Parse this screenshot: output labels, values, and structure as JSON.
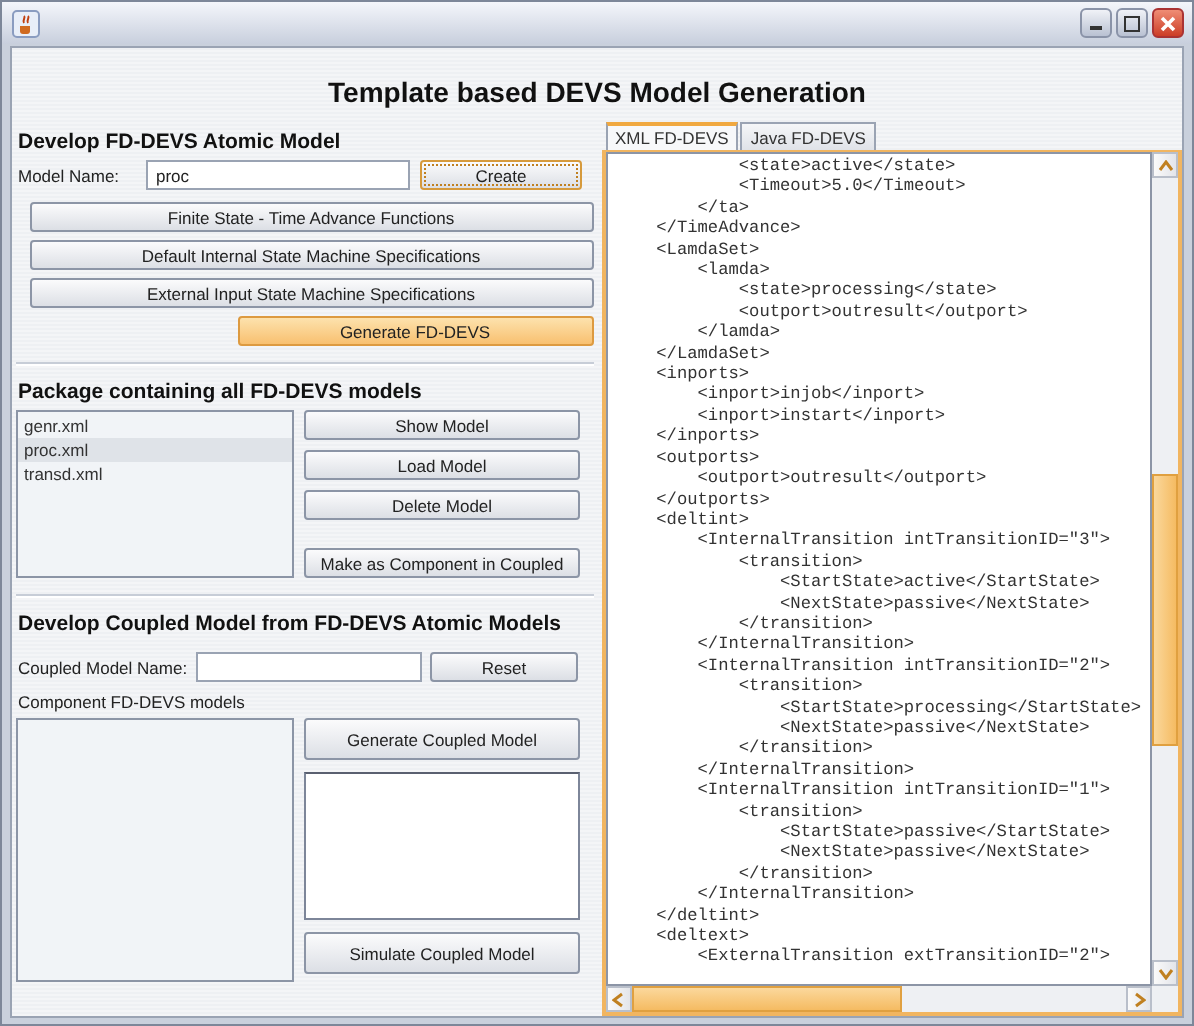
{
  "heading": "Template based DEVS Model Generation",
  "atomic": {
    "title": "Develop FD-DEVS Atomic Model",
    "name_label": "Model Name:",
    "name_value": "proc",
    "create_button": "Create",
    "buttons": [
      {
        "label": "Finite State - Time Advance Functions",
        "highlighted": false
      },
      {
        "label": "Default Internal State Machine Specifications",
        "highlighted": false
      },
      {
        "label": "External Input State Machine Specifications",
        "highlighted": false
      },
      {
        "label": "Generate FD-DEVS",
        "highlighted": true
      }
    ]
  },
  "package": {
    "title": "Package containing all FD-DEVS models",
    "items": [
      {
        "label": "genr.xml",
        "selected": false
      },
      {
        "label": "proc.xml",
        "selected": true
      },
      {
        "label": "transd.xml",
        "selected": false
      }
    ],
    "buttons": [
      "Show Model",
      "Load Model",
      "Delete Model",
      "Make as Component in Coupled"
    ]
  },
  "coupled": {
    "title": "Develop Coupled Model from FD-DEVS Atomic Models",
    "name_label": "Coupled Model Name:",
    "reset_button": "Reset",
    "components_label": "Component FD-DEVS models",
    "generate_button": "Generate Coupled Model",
    "simulate_button": "Simulate Coupled Model"
  },
  "tabs": [
    {
      "label": "XML FD-DEVS",
      "selected": true
    },
    {
      "label": "Java FD-DEVS",
      "selected": false
    }
  ],
  "code_lines": [
    "            <state>active</state>",
    "            <Timeout>5.0</Timeout>",
    "        </ta>",
    "    </TimeAdvance>",
    "    <LamdaSet>",
    "        <lamda>",
    "            <state>processing</state>",
    "            <outport>outresult</outport>",
    "        </lamda>",
    "    </LamdaSet>",
    "    <inports>",
    "        <inport>injob</inport>",
    "        <inport>instart</inport>",
    "    </inports>",
    "    <outports>",
    "        <outport>outresult</outport>",
    "    </outports>",
    "    <deltint>",
    "        <InternalTransition intTransitionID=\"3\">",
    "            <transition>",
    "                <StartState>active</StartState>",
    "                <NextState>passive</NextState>",
    "            </transition>",
    "        </InternalTransition>",
    "        <InternalTransition intTransitionID=\"2\">",
    "            <transition>",
    "                <StartState>processing</StartState>",
    "                <NextState>passive</NextState>",
    "            </transition>",
    "        </InternalTransition>",
    "        <InternalTransition intTransitionID=\"1\">",
    "            <transition>",
    "                <StartState>passive</StartState>",
    "                <NextState>passive</NextState>",
    "            </transition>",
    "        </InternalTransition>",
    "    </deltint>",
    "    <deltext>",
    "        <ExternalTransition extTransitionID=\"2\">"
  ]
}
